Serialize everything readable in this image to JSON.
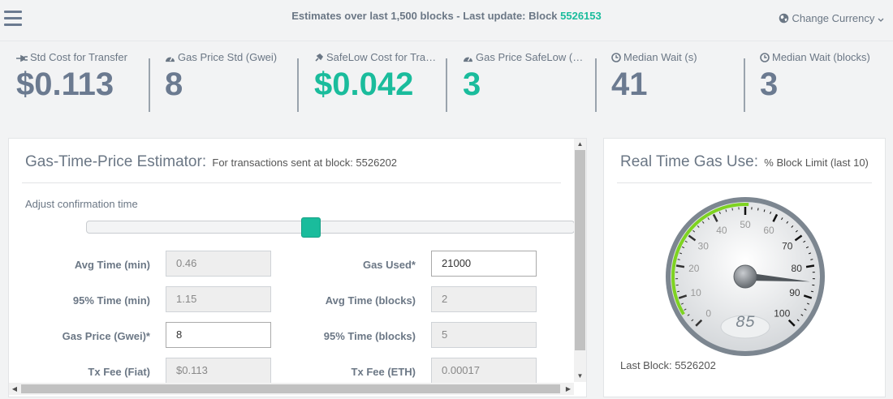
{
  "header": {
    "estimates_text": "Estimates over last 1,500 blocks - Last update: Block ",
    "block_number": "5526153",
    "currency_label": "Change Currency",
    "currency_icon": "globe-icon",
    "menu_icon": "hamburger-icon"
  },
  "stats": [
    {
      "label": "Std Cost for Transfer",
      "value": "$0.113",
      "icon": "plug-icon"
    },
    {
      "label": "Gas Price Std (Gwei)",
      "value": "8",
      "icon": "gauge-icon"
    },
    {
      "label": "SafeLow Cost for Tra…",
      "value": "$0.042",
      "icon": "plug-icon"
    },
    {
      "label": "Gas Price SafeLow (…",
      "value": "3",
      "icon": "gauge-icon"
    },
    {
      "label": "Median Wait (s)",
      "value": "41",
      "icon": "clock-icon"
    },
    {
      "label": "Median Wait (blocks)",
      "value": "3",
      "icon": "clock-icon"
    }
  ],
  "estimator": {
    "title": "Gas-Time-Price Estimator:",
    "subtitle": "For transactions sent at block: 5526202",
    "adjust_label": "Adjust confirmation time",
    "slider_value": 0.46,
    "fields_left": [
      {
        "label": "Avg Time (min)",
        "value": "0.46"
      },
      {
        "label": "95% Time (min)",
        "value": "1.15"
      },
      {
        "label": "Gas Price (Gwei)*",
        "value": "8"
      },
      {
        "label": "Tx Fee (Fiat)",
        "value": "$0.113"
      }
    ],
    "fields_right": [
      {
        "label": "Gas Used*",
        "value": "21000"
      },
      {
        "label": "Avg Time (blocks)",
        "value": "2"
      },
      {
        "label": "95% Time (blocks)",
        "value": "5"
      },
      {
        "label": "Tx Fee (ETH)",
        "value": "0.00017"
      }
    ]
  },
  "gas_use": {
    "title": "Real Time Gas Use:",
    "subtitle": "% Block Limit (last 10)",
    "gauge_value": 85,
    "gauge_display": "85",
    "gauge_ticks": [
      "0",
      "10",
      "20",
      "30",
      "40",
      "50",
      "60",
      "70",
      "80",
      "90",
      "100"
    ],
    "last_block": "Last Block: 5526202",
    "accent": "#7ed321"
  },
  "colors": {
    "accent": "#1abc9c",
    "text": "#6b7785"
  }
}
